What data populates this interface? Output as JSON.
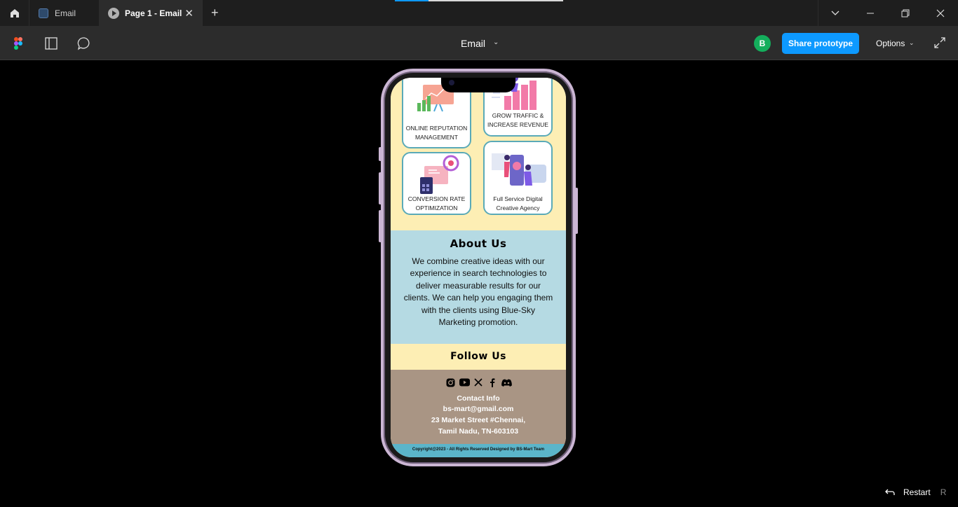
{
  "tabs": [
    {
      "label": "Email"
    },
    {
      "label": "Page 1 - Email"
    }
  ],
  "toolbar": {
    "file_title": "Email",
    "avatar_initial": "B",
    "share_label": "Share prototype",
    "options_label": "Options"
  },
  "prototype": {
    "services": [
      {
        "label_line1": "ONLINE REPUTATION",
        "label_line2": "MANAGEMENT"
      },
      {
        "label_line1": "GROW TRAFFIC &",
        "label_line2": "INCREASE REVENUE"
      },
      {
        "label_line1": "CONVERSION  RATE",
        "label_line2": "OPTIMIZATION"
      },
      {
        "label_line1": "Full Service Digital",
        "label_line2": "Creative Agency"
      }
    ],
    "about": {
      "heading": "About Us",
      "body": "We combine creative ideas with our experience in search technologies to deliver measurable results for our clients. We can help you engaging them with the clients using Blue-Sky Marketing promotion."
    },
    "follow": {
      "heading": "Follow Us"
    },
    "contact": {
      "title": "Contact Info",
      "email": "bs-mart@gmail.com",
      "address1": "23 Market Street #Chennai,",
      "address2": "Tamil Nadu, TN-603103"
    },
    "footer": "Copyright@2023 - All Rights Reserved Designed by BS-Mart Team"
  },
  "restart": {
    "label": "Restart",
    "shortcut": "R"
  },
  "colors": {
    "accent": "#0d99ff",
    "avatar": "#14ae5c",
    "yellow": "#fdeeb4",
    "about_bg": "#b5dae3",
    "contact_bg": "#a99584",
    "footer_bg": "#5bb5ca"
  }
}
